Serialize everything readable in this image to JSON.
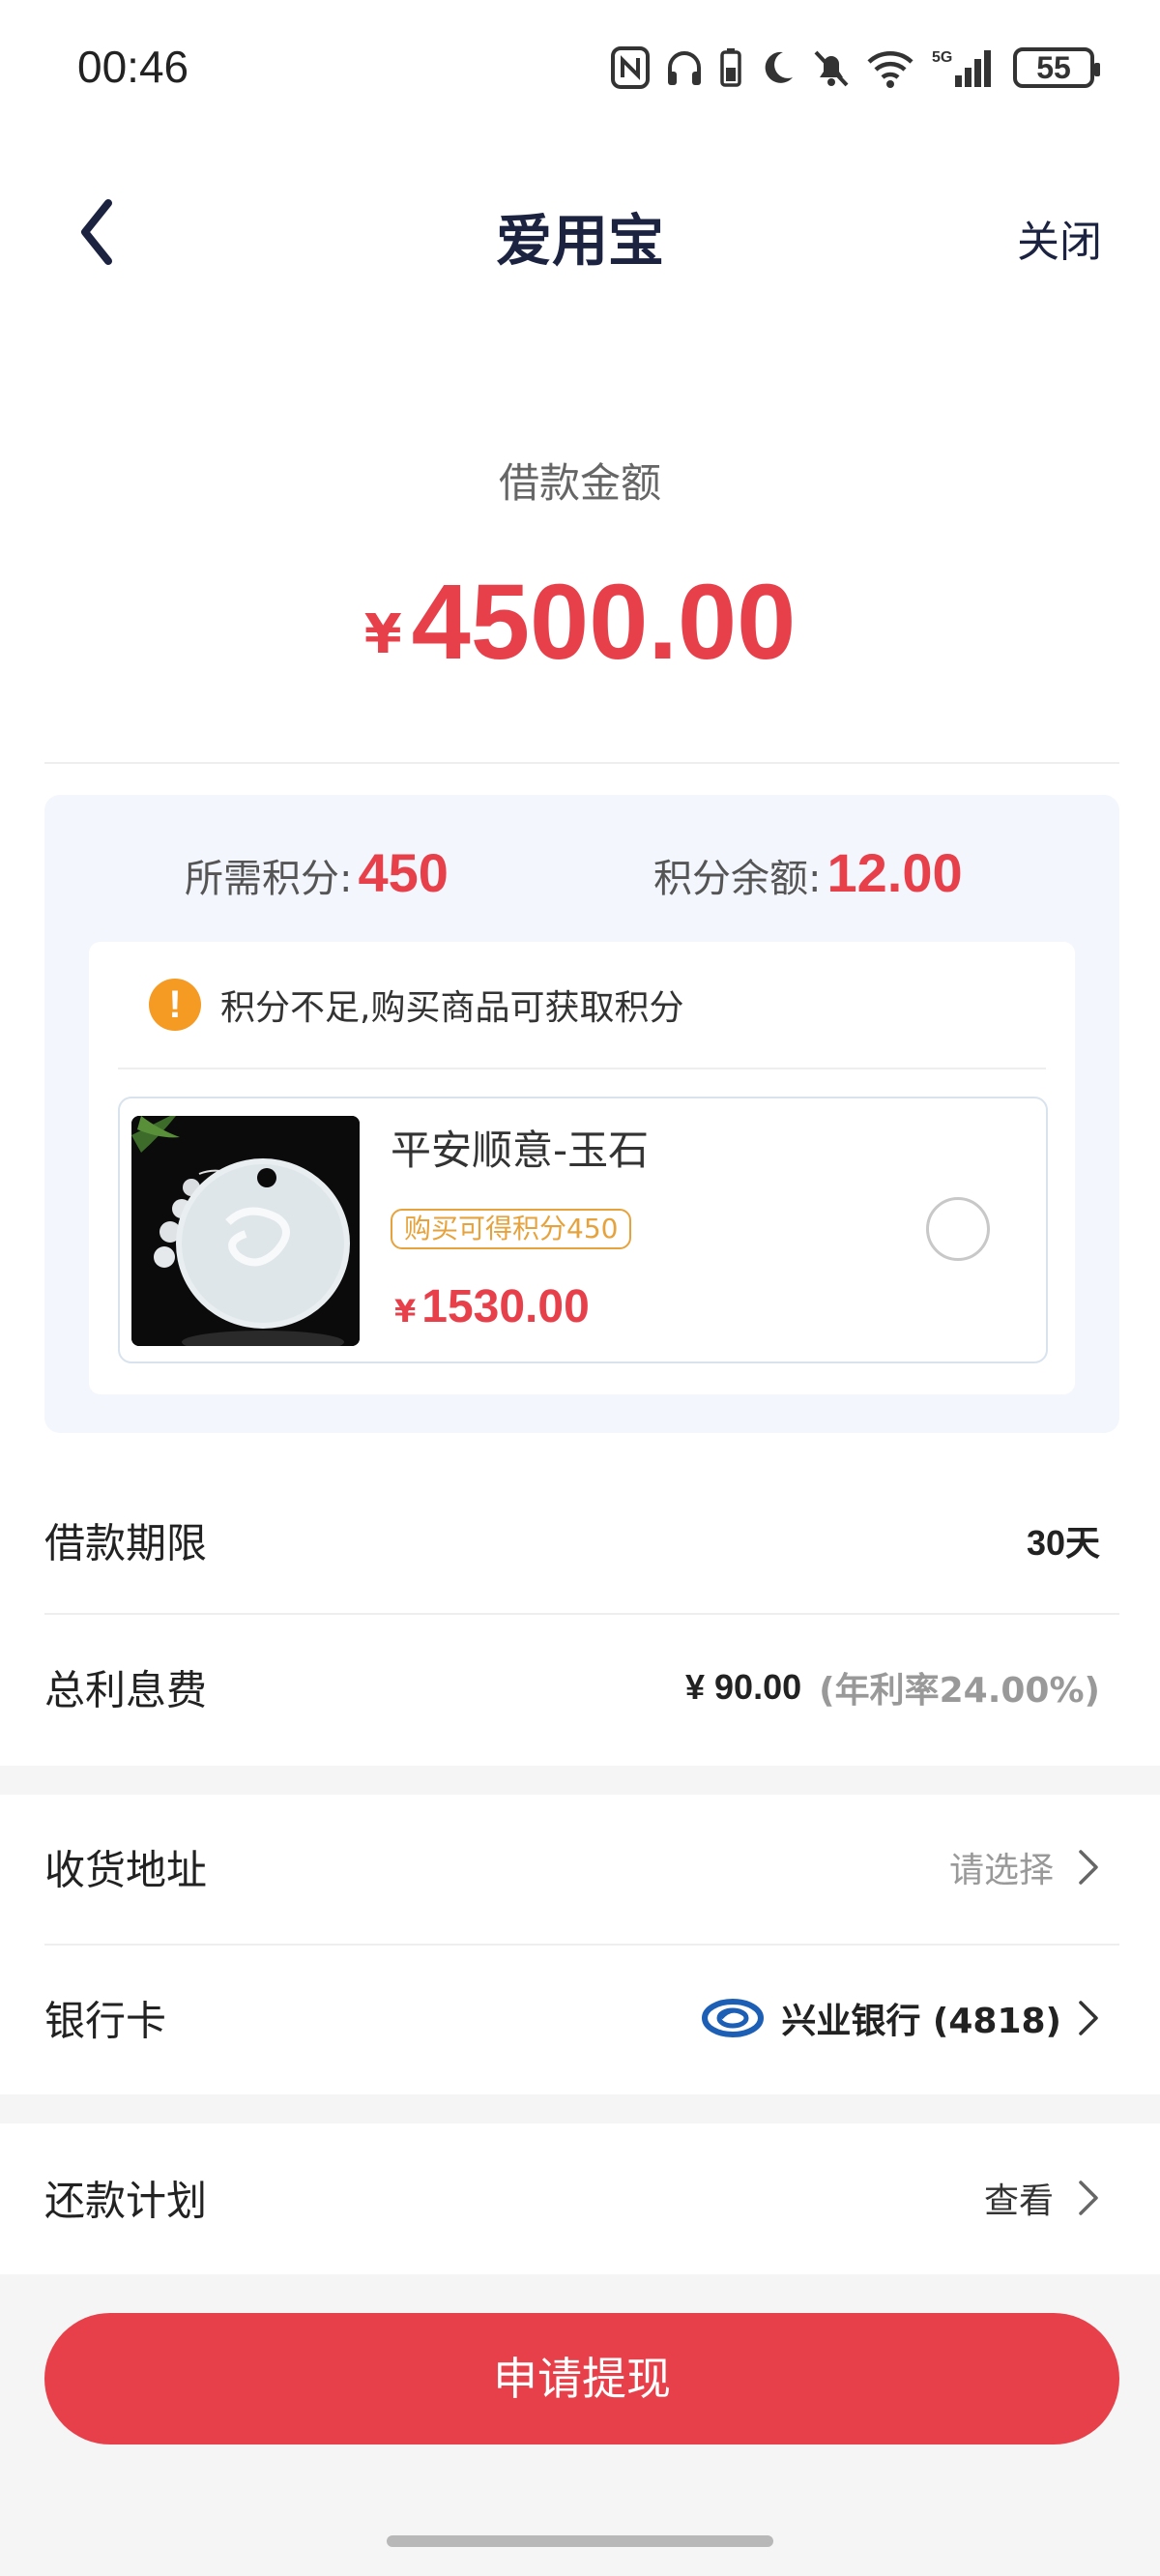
{
  "status_bar": {
    "time": "00:46",
    "battery": "55",
    "network": "5G"
  },
  "nav": {
    "title": "爱用宝",
    "close_label": "关闭"
  },
  "loan": {
    "amount_label": "借款金额",
    "currency": "¥",
    "amount": "4500.00"
  },
  "points": {
    "required_label": "所需积分:",
    "required_value": "450",
    "balance_label": "积分余额:",
    "balance_value": "12.00",
    "warning_text": "积分不足,购买商品可获取积分",
    "product": {
      "name": "平安顺意-玉石",
      "badge": "购买可得积分450",
      "currency": "¥",
      "price": "1530.00",
      "selected": false
    }
  },
  "details": {
    "term_label": "借款期限",
    "term_value": "30天",
    "interest_label": "总利息费",
    "interest_value": "¥ 90.00",
    "interest_rate": "(年利率24.00%)",
    "address_label": "收货地址",
    "address_placeholder": "请选择",
    "bank_label": "银行卡",
    "bank_name": "兴业银行 (4818)",
    "plan_label": "还款计划",
    "plan_action": "查看"
  },
  "actions": {
    "submit_label": "申请提现"
  },
  "colors": {
    "accent_red": "#e8404a",
    "warning_orange": "#f59a23",
    "badge_orange": "#e6a23c",
    "nav_title": "#1c2340"
  },
  "icons": {
    "back": "chevron-left-icon",
    "warning": "exclamation-icon",
    "chevron": "chevron-right-icon",
    "bank": "bank-logo-icon"
  }
}
